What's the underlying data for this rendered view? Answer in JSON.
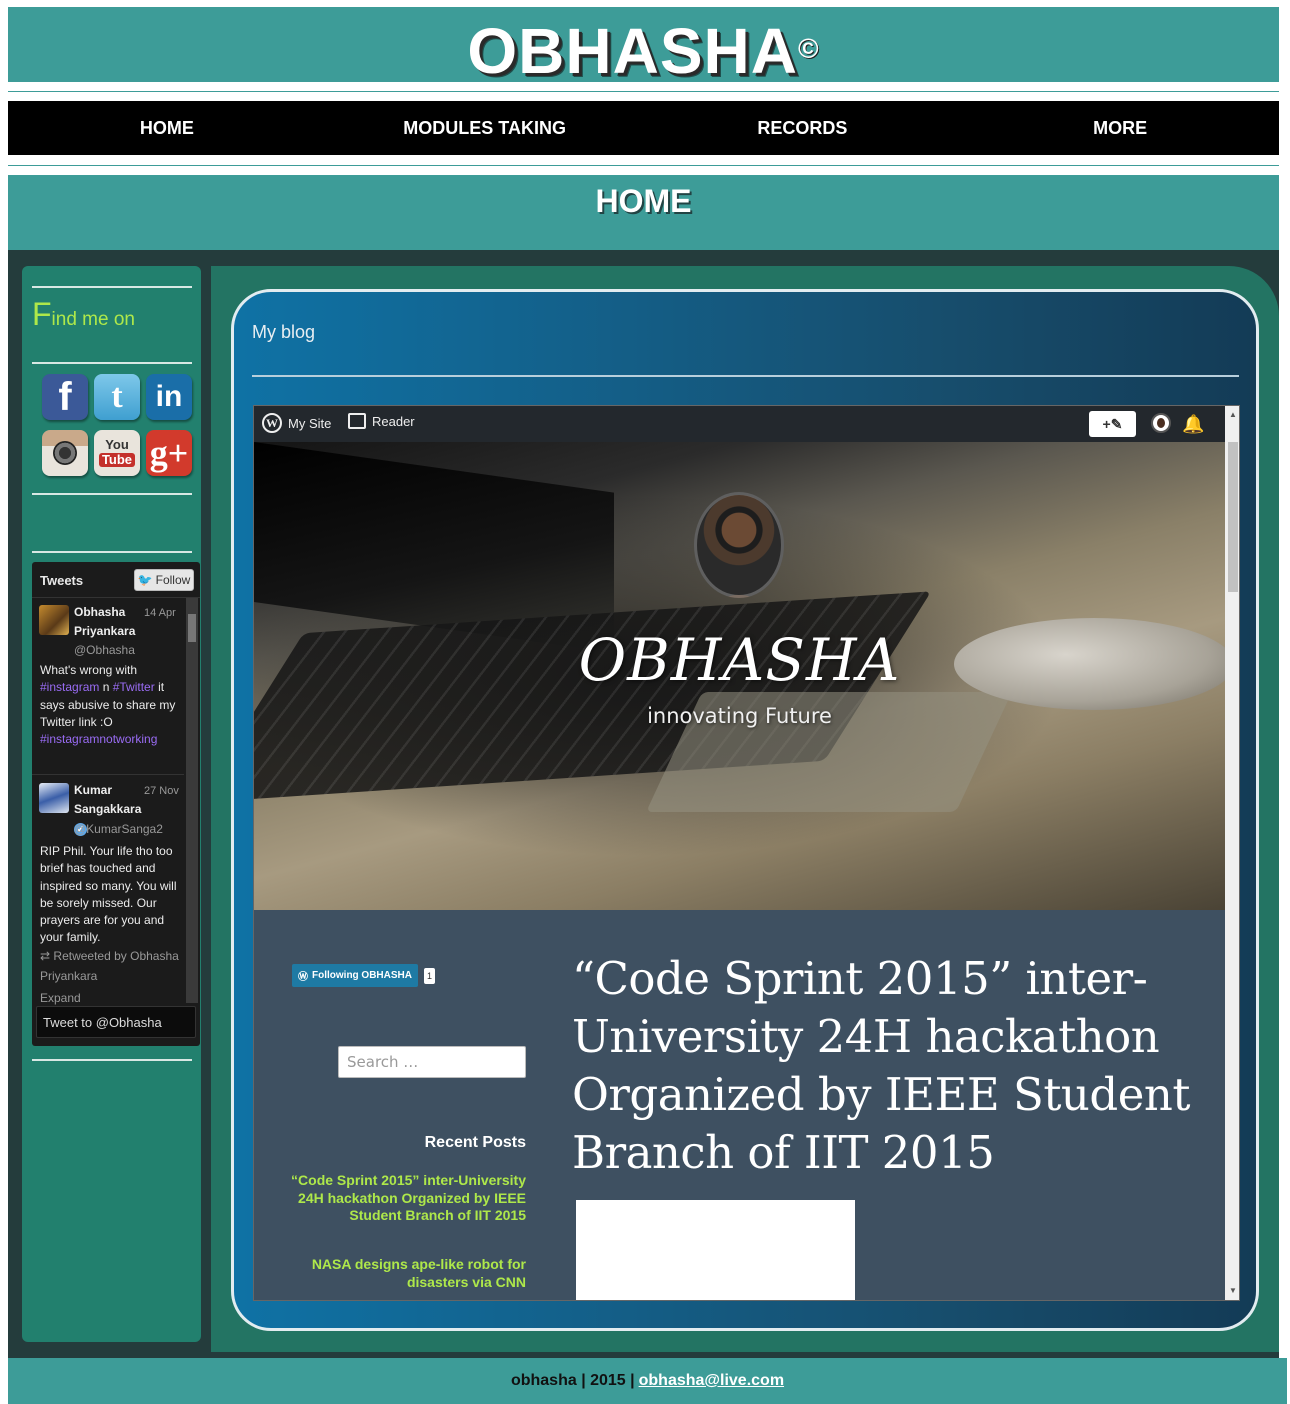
{
  "header": {
    "title": "OBHASHA",
    "copyright": "©"
  },
  "nav": {
    "items": [
      {
        "label": "HOME"
      },
      {
        "label": "MODULES TAKING"
      },
      {
        "label": "RECORDS"
      },
      {
        "label": "MORE"
      }
    ]
  },
  "page": {
    "title": "HOME"
  },
  "sidebar": {
    "find_first": "F",
    "find_rest": "ind me on",
    "social": [
      {
        "icon": "facebook-icon",
        "glyph": "f",
        "color": "#3b5998"
      },
      {
        "icon": "twitter-icon",
        "glyph": "t",
        "color": "#4aa8d8"
      },
      {
        "icon": "linkedin-icon",
        "glyph": "in",
        "color": "#1a6ea8"
      },
      {
        "icon": "instagram-icon",
        "glyph": "◉",
        "color": "#8a6a4e"
      },
      {
        "icon": "youtube-icon",
        "glyph": "You Tube",
        "color": "#e23d2f"
      },
      {
        "icon": "googleplus-icon",
        "glyph": "g+",
        "color": "#d23a2c"
      }
    ]
  },
  "tweets": {
    "title": "Tweets",
    "follow_label": "Follow",
    "items": [
      {
        "name_line1": "Obhasha",
        "name_line2": "Priyankara",
        "date": "14 Apr",
        "handle": "@Obhasha",
        "text_parts": [
          "What's wrong with ",
          "#instagram",
          " n ",
          "#Twitter",
          " it says abusive to share my Twitter link :O ",
          "#instagramnotworking"
        ]
      },
      {
        "name_line1": "Kumar",
        "name_line2": "Sangakkara",
        "date": "27 Nov",
        "handle": "@KumarSanga2",
        "text": "RIP Phil. Your life tho too brief has touched and inspired so many. You will be sorely missed. Our prayers are for you and your family.",
        "retweet": "Retweeted by Obhasha Priyankara",
        "expand": "Expand"
      }
    ],
    "tweet_to": "Tweet to @Obhasha"
  },
  "blog": {
    "title": "My blog",
    "wpbar": {
      "my_site": "My Site",
      "reader": "Reader",
      "write": "+✎"
    },
    "hero": {
      "title": "OBHASHA",
      "tagline": "innovating Future"
    },
    "following": {
      "label": "Following OBHASHA",
      "count": "1"
    },
    "search_placeholder": "Search …",
    "recent_title": "Recent Posts",
    "recent_posts": [
      "“Code Sprint 2015” inter-University 24H hackathon Organized by IEEE Student Branch of IIT 2015",
      "NASA designs ape-like robot for disasters via CNN"
    ],
    "post_title": "“Code Sprint 2015” inter-University 24H hackathon Organized by IEEE Student Branch of IIT 2015"
  },
  "footer": {
    "text": "obhasha | 2015 |",
    "email": "obhasha@live.com"
  }
}
